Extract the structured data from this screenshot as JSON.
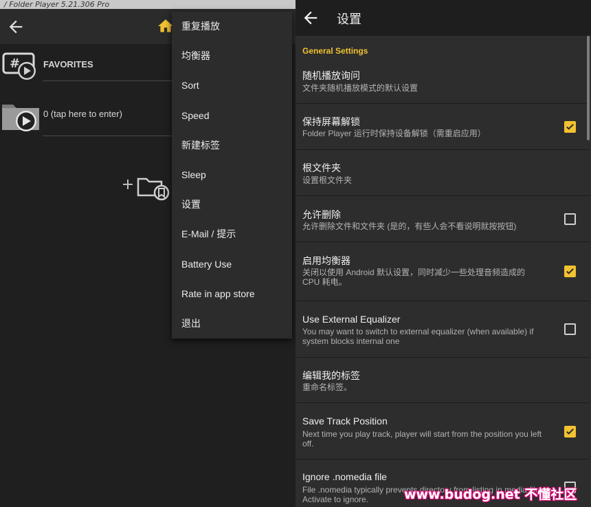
{
  "left": {
    "title_bar": "/ Folder Player 5.21.306  Pro",
    "rows": [
      {
        "label": "FAVORITES"
      },
      {
        "label": "0 (tap here to enter)"
      }
    ]
  },
  "menu": {
    "items": [
      {
        "label": "重复播放"
      },
      {
        "label": "均衡器"
      },
      {
        "label": "Sort"
      },
      {
        "label": "Speed"
      },
      {
        "label": "新建标签"
      },
      {
        "label": "Sleep"
      },
      {
        "label": "设置"
      },
      {
        "label": "E-Mail / 提示"
      },
      {
        "label": "Battery Use"
      },
      {
        "label": "Rate in app store"
      },
      {
        "label": "退出"
      }
    ]
  },
  "settings": {
    "title": "设置",
    "section": "General Settings",
    "items": [
      {
        "title": "随机播放询问",
        "subtitle": "文件夹随机播放模式的默认设置",
        "checkbox": null
      },
      {
        "title": "保持屏幕解锁",
        "subtitle": "Folder Player 运行时保持设备解锁（需重启应用）",
        "checkbox": true
      },
      {
        "title": "根文件夹",
        "subtitle": "设置根文件夹",
        "checkbox": null
      },
      {
        "title": "允许删除",
        "subtitle": "允许删除文件和文件夹 (是的，有些人会不看说明就按按钮)",
        "checkbox": false
      },
      {
        "title": "启用均衡器",
        "subtitle": "关闭以使用 Android 默认设置，同时减少一些处理音频造成的 CPU 耗电。",
        "checkbox": true
      },
      {
        "title": "Use External Equalizer",
        "subtitle": "You may want to switch to external equalizer (when available) if system blocks internal one",
        "checkbox": false
      },
      {
        "title": "编辑我的标签",
        "subtitle": "重命名标签。",
        "checkbox": null
      },
      {
        "title": "Save Track Position",
        "subtitle": "Next time you play track, player will start from the position you left off.",
        "checkbox": true
      },
      {
        "title": "Ignore .nomedia file",
        "subtitle": "File .nomedia typically prevents directory from listing in media files. Activate to ignore.",
        "checkbox": false
      }
    ]
  },
  "watermark": "www.budog.net 不懂社区",
  "colors": {
    "accent": "#f2c231",
    "background": "#2d2d2d",
    "menu_bg": "#2c2c2c"
  }
}
